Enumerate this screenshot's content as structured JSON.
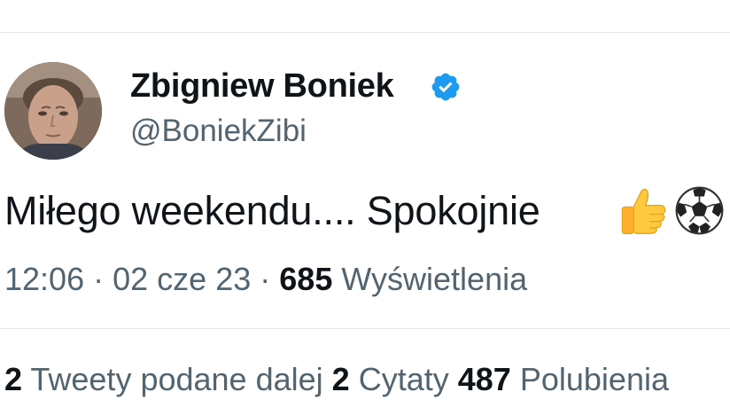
{
  "tweet": {
    "author": {
      "display_name": "Zbigniew Boniek",
      "handle": "@BoniekZibi",
      "verified": true,
      "verified_color": "#1d9bf0"
    },
    "text": "Miłego weekendu.... Spokojnie",
    "emojis": [
      "thumbs-up",
      "soccer-ball"
    ],
    "time": "12:06",
    "separator": "·",
    "date": "02 cze 23",
    "views_count": "685",
    "views_label": "Wyświetlenia"
  },
  "stats": {
    "retweets_count": "2",
    "retweets_label": "Tweety podane dalej",
    "quotes_count": "2",
    "quotes_label": "Cytaty",
    "likes_count": "487",
    "likes_label": "Polubienia"
  },
  "colors": {
    "text_primary": "#0f1419",
    "text_secondary": "#536471",
    "divider": "#e4e7ea"
  }
}
